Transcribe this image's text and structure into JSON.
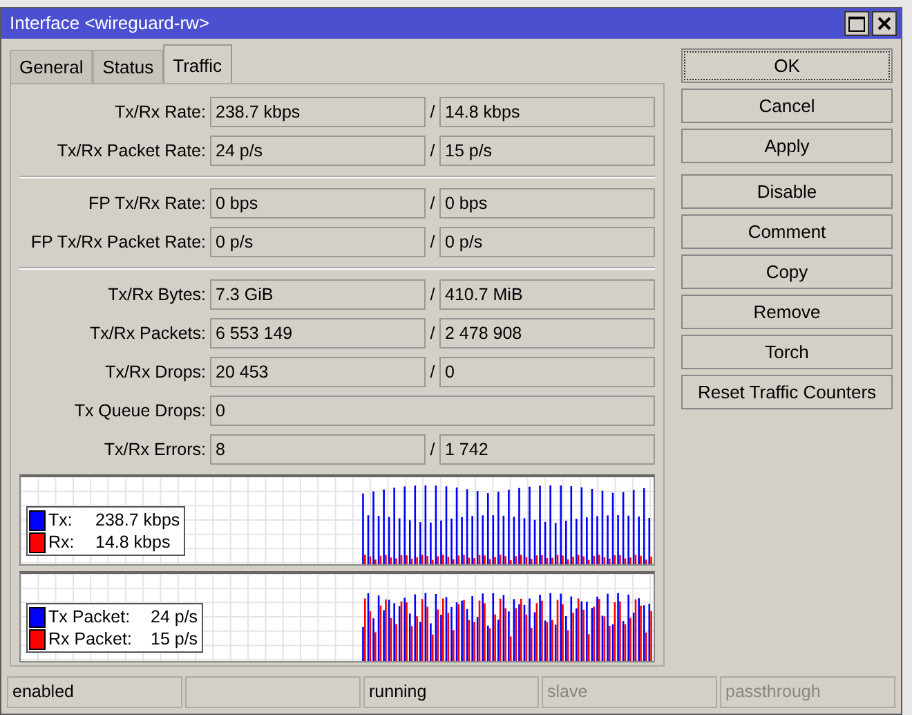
{
  "window": {
    "title": "Interface <wireguard-rw>"
  },
  "tabs": [
    {
      "label": "General",
      "selected": false
    },
    {
      "label": "Status",
      "selected": false
    },
    {
      "label": "Traffic",
      "selected": true
    }
  ],
  "sections": [
    {
      "rows": [
        {
          "label": "Tx/Rx Rate:",
          "values": [
            "238.7 kbps",
            "14.8 kbps"
          ],
          "separator": "/"
        },
        {
          "label": "Tx/Rx Packet Rate:",
          "values": [
            "24 p/s",
            "15 p/s"
          ],
          "separator": "/"
        }
      ]
    },
    {
      "rows": [
        {
          "label": "FP Tx/Rx Rate:",
          "values": [
            "0 bps",
            "0 bps"
          ],
          "separator": "/"
        },
        {
          "label": "FP Tx/Rx Packet Rate:",
          "values": [
            "0 p/s",
            "0 p/s"
          ],
          "separator": "/"
        }
      ]
    },
    {
      "rows": [
        {
          "label": "Tx/Rx Bytes:",
          "values": [
            "7.3 GiB",
            "410.7 MiB"
          ],
          "separator": "/"
        },
        {
          "label": "Tx/Rx Packets:",
          "values": [
            "6 553 149",
            "2 478 908"
          ],
          "separator": "/"
        },
        {
          "label": "Tx/Rx Drops:",
          "values": [
            "20 453",
            "0"
          ],
          "separator": "/"
        },
        {
          "label": "Tx Queue Drops:",
          "values": [
            "0"
          ]
        },
        {
          "label": "Tx/Rx Errors:",
          "values": [
            "8",
            "1 742"
          ],
          "separator": "/"
        }
      ]
    }
  ],
  "graphs": [
    {
      "kind": "rate",
      "legend": [
        {
          "label": "Tx:",
          "value": "238.7 kbps",
          "color": "#0000ff"
        },
        {
          "label": "Rx:",
          "value": "14.8 kbps",
          "color": "#ff0000"
        }
      ]
    },
    {
      "kind": "packets",
      "legend": [
        {
          "label": "Tx Packet:",
          "value": "24 p/s",
          "color": "#0000ff"
        },
        {
          "label": "Rx Packet:",
          "value": "15 p/s",
          "color": "#ff0000"
        }
      ]
    }
  ],
  "button_groups": [
    [
      {
        "label": "OK",
        "focused": true
      },
      {
        "label": "Cancel",
        "focused": false
      },
      {
        "label": "Apply",
        "focused": false
      }
    ],
    [
      {
        "label": "Disable",
        "focused": false
      },
      {
        "label": "Comment",
        "focused": false
      },
      {
        "label": "Copy",
        "focused": false
      },
      {
        "label": "Remove",
        "focused": false
      },
      {
        "label": "Torch",
        "focused": false
      },
      {
        "label": "Reset Traffic Counters",
        "focused": false
      }
    ]
  ],
  "status_bar": [
    {
      "kind": "text",
      "text": "enabled",
      "disabled": false
    },
    {
      "kind": "blank"
    },
    {
      "kind": "text",
      "text": "running",
      "disabled": false
    },
    {
      "kind": "text",
      "text": "slave",
      "disabled": true
    },
    {
      "kind": "text",
      "text": "passthrough",
      "disabled": true
    }
  ]
}
